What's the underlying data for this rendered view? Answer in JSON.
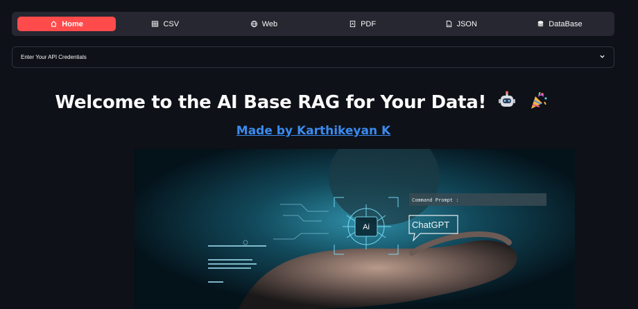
{
  "nav": {
    "items": [
      {
        "label": "Home",
        "icon": "home-icon"
      },
      {
        "label": "CSV",
        "icon": "table-icon"
      },
      {
        "label": "Web",
        "icon": "globe-icon"
      },
      {
        "label": "PDF",
        "icon": "pdf-file-icon"
      },
      {
        "label": "JSON",
        "icon": "file-icon"
      },
      {
        "label": "DataBase",
        "icon": "database-icon"
      }
    ],
    "active_color": "#ff4b4b"
  },
  "expander": {
    "label": "Enter Your API Credentials"
  },
  "main": {
    "title": "Welcome to the AI Base RAG for Your Data!",
    "link_text": "Made by Karthikeyan K"
  },
  "hero": {
    "command_prompt": "Command Prompt :",
    "chatgpt": "ChatGPT",
    "ai_chip": "Ai"
  },
  "colors": {
    "background": "#0e1117",
    "navbar": "#262730",
    "link": "#3b8bf0"
  }
}
